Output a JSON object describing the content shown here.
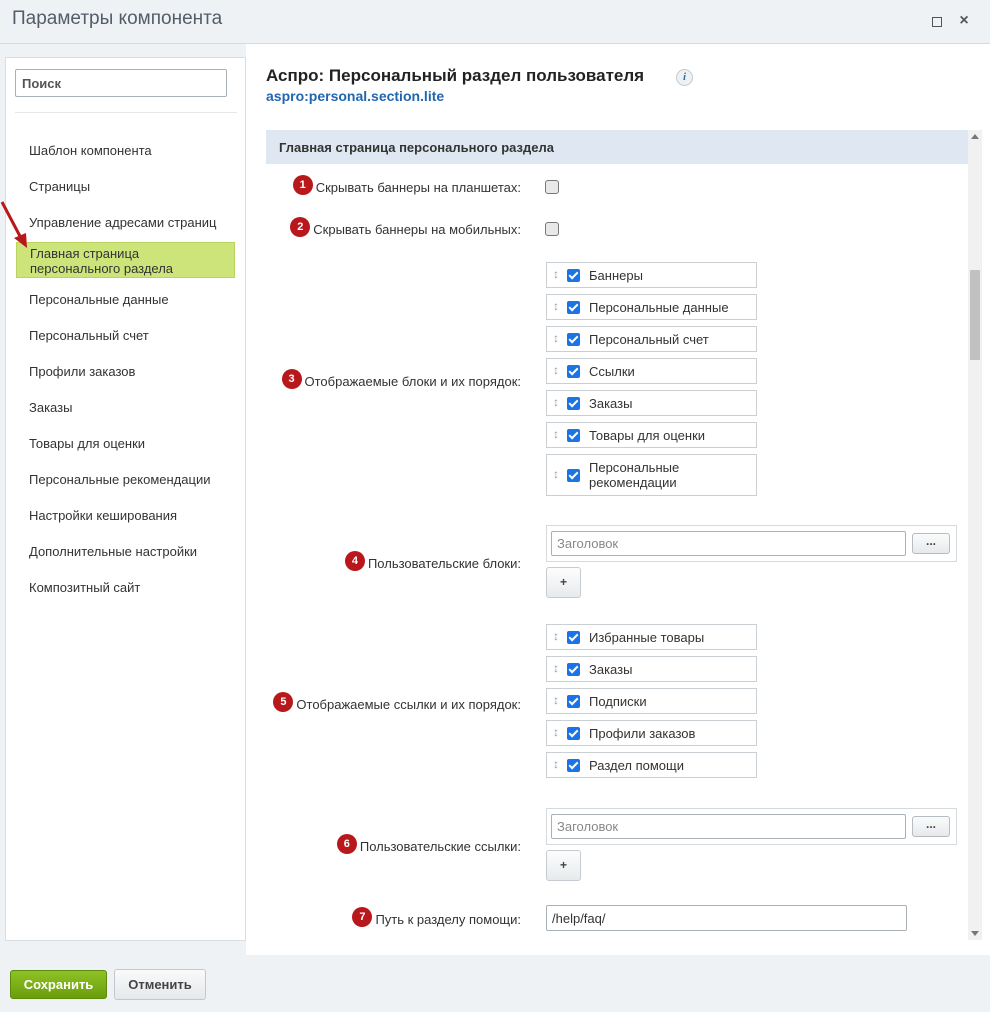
{
  "window": {
    "title": "Параметры компонента"
  },
  "sidebar": {
    "search_placeholder": "Поиск",
    "items": [
      {
        "label": "Шаблон компонента"
      },
      {
        "label": "Страницы"
      },
      {
        "label": "Управление адресами страниц"
      },
      {
        "label": "Главная страница персонального раздела",
        "line1": "Главная страница",
        "line2": "персонального раздела",
        "active": true
      },
      {
        "label": "Персональные данные"
      },
      {
        "label": "Персональный счет"
      },
      {
        "label": "Профили заказов"
      },
      {
        "label": "Заказы"
      },
      {
        "label": "Товары для оценки"
      },
      {
        "label": "Персональные рекомендации"
      },
      {
        "label": "Настройки кеширования"
      },
      {
        "label": "Дополнительные настройки"
      },
      {
        "label": "Композитный сайт"
      }
    ]
  },
  "component": {
    "title": "Аспро: Персональный раздел пользователя",
    "code": "aspro:personal.section.lite",
    "info_icon": "i"
  },
  "section": {
    "title": "Главная страница персонального раздела",
    "fields": {
      "hide_tablet": {
        "badge": "1",
        "label": "Скрывать баннеры на планшетах:",
        "checked": false
      },
      "hide_mobile": {
        "badge": "2",
        "label": "Скрывать баннеры на мобильных:",
        "checked": false
      },
      "blocks": {
        "badge": "3",
        "label": "Отображаемые блоки и их порядок:",
        "items": [
          {
            "text": "Баннеры",
            "checked": true
          },
          {
            "text": "Персональные данные",
            "checked": true
          },
          {
            "text": "Персональный счет",
            "checked": true
          },
          {
            "text": "Ссылки",
            "checked": true
          },
          {
            "text": "Заказы",
            "checked": true
          },
          {
            "text": "Товары для оценки",
            "checked": true
          },
          {
            "text": "Персональные рекомендации",
            "line1": "Персональные",
            "line2": "рекомендации",
            "checked": true
          }
        ]
      },
      "user_blocks": {
        "badge": "4",
        "label": "Пользовательские блоки:",
        "placeholder": "Заголовок",
        "more": "...",
        "add": "+"
      },
      "links": {
        "badge": "5",
        "label": "Отображаемые ссылки и их порядок:",
        "items": [
          {
            "text": "Избранные товары",
            "checked": true
          },
          {
            "text": "Заказы",
            "checked": true
          },
          {
            "text": "Подписки",
            "checked": true
          },
          {
            "text": "Профили заказов",
            "checked": true
          },
          {
            "text": "Раздел помощи",
            "checked": true
          }
        ]
      },
      "user_links": {
        "badge": "6",
        "label": "Пользовательские ссылки:",
        "placeholder": "Заголовок",
        "more": "...",
        "add": "+"
      },
      "help_path": {
        "badge": "7",
        "label": "Путь к разделу помощи:",
        "value": "/help/faq/"
      }
    }
  },
  "footer": {
    "save": "Сохранить",
    "cancel": "Отменить"
  },
  "colors": {
    "accent_green": "#8fc225",
    "badge_red": "#b8181c",
    "link_blue": "#2067b0",
    "checkbox_blue": "#1a73e8"
  },
  "icons": {
    "drag": "↕",
    "maximize": "maximize-icon",
    "close": "×"
  }
}
